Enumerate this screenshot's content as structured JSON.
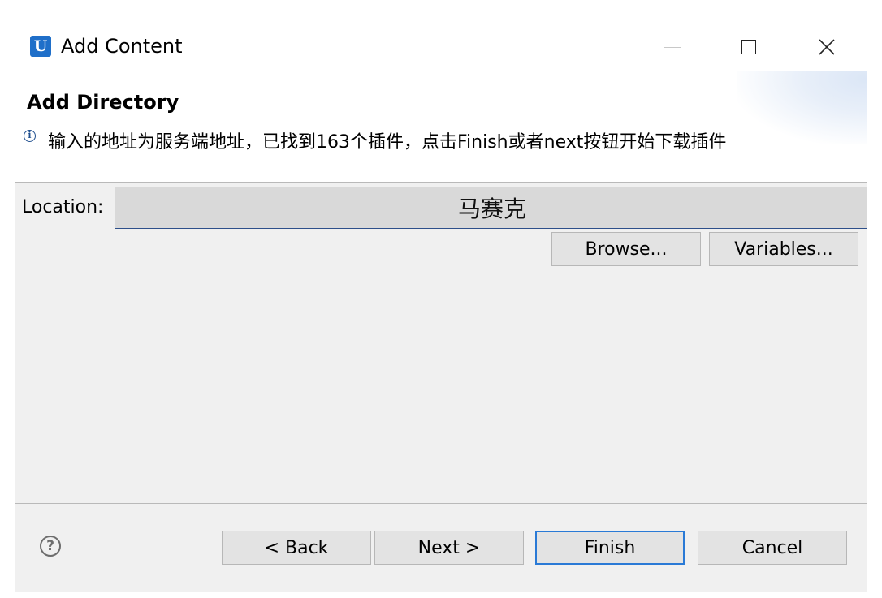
{
  "window": {
    "app_icon_letter": "U",
    "title": "Add Content",
    "max_glyph": "",
    "close_glyph": "✕"
  },
  "header": {
    "heading": "Add Directory",
    "info_icon_glyph": "i",
    "message": "输入的地址为服务端地址，已找到163个插件，点击Finish或者next按钮开始下载插件"
  },
  "location": {
    "label": "Location:",
    "value": "马赛克"
  },
  "buttons": {
    "browse": "Browse...",
    "variables": "Variables...",
    "back": "< Back",
    "next": "Next >",
    "finish": "Finish",
    "cancel": "Cancel"
  },
  "footer": {
    "help_glyph": "?"
  },
  "icons": {
    "app": "app-logo-icon",
    "info": "info-icon",
    "help": "help-icon"
  },
  "colors": {
    "accent": "#2a7ad6",
    "app_icon": "#1f6fc9",
    "info_icon": "#1f4f8f"
  }
}
